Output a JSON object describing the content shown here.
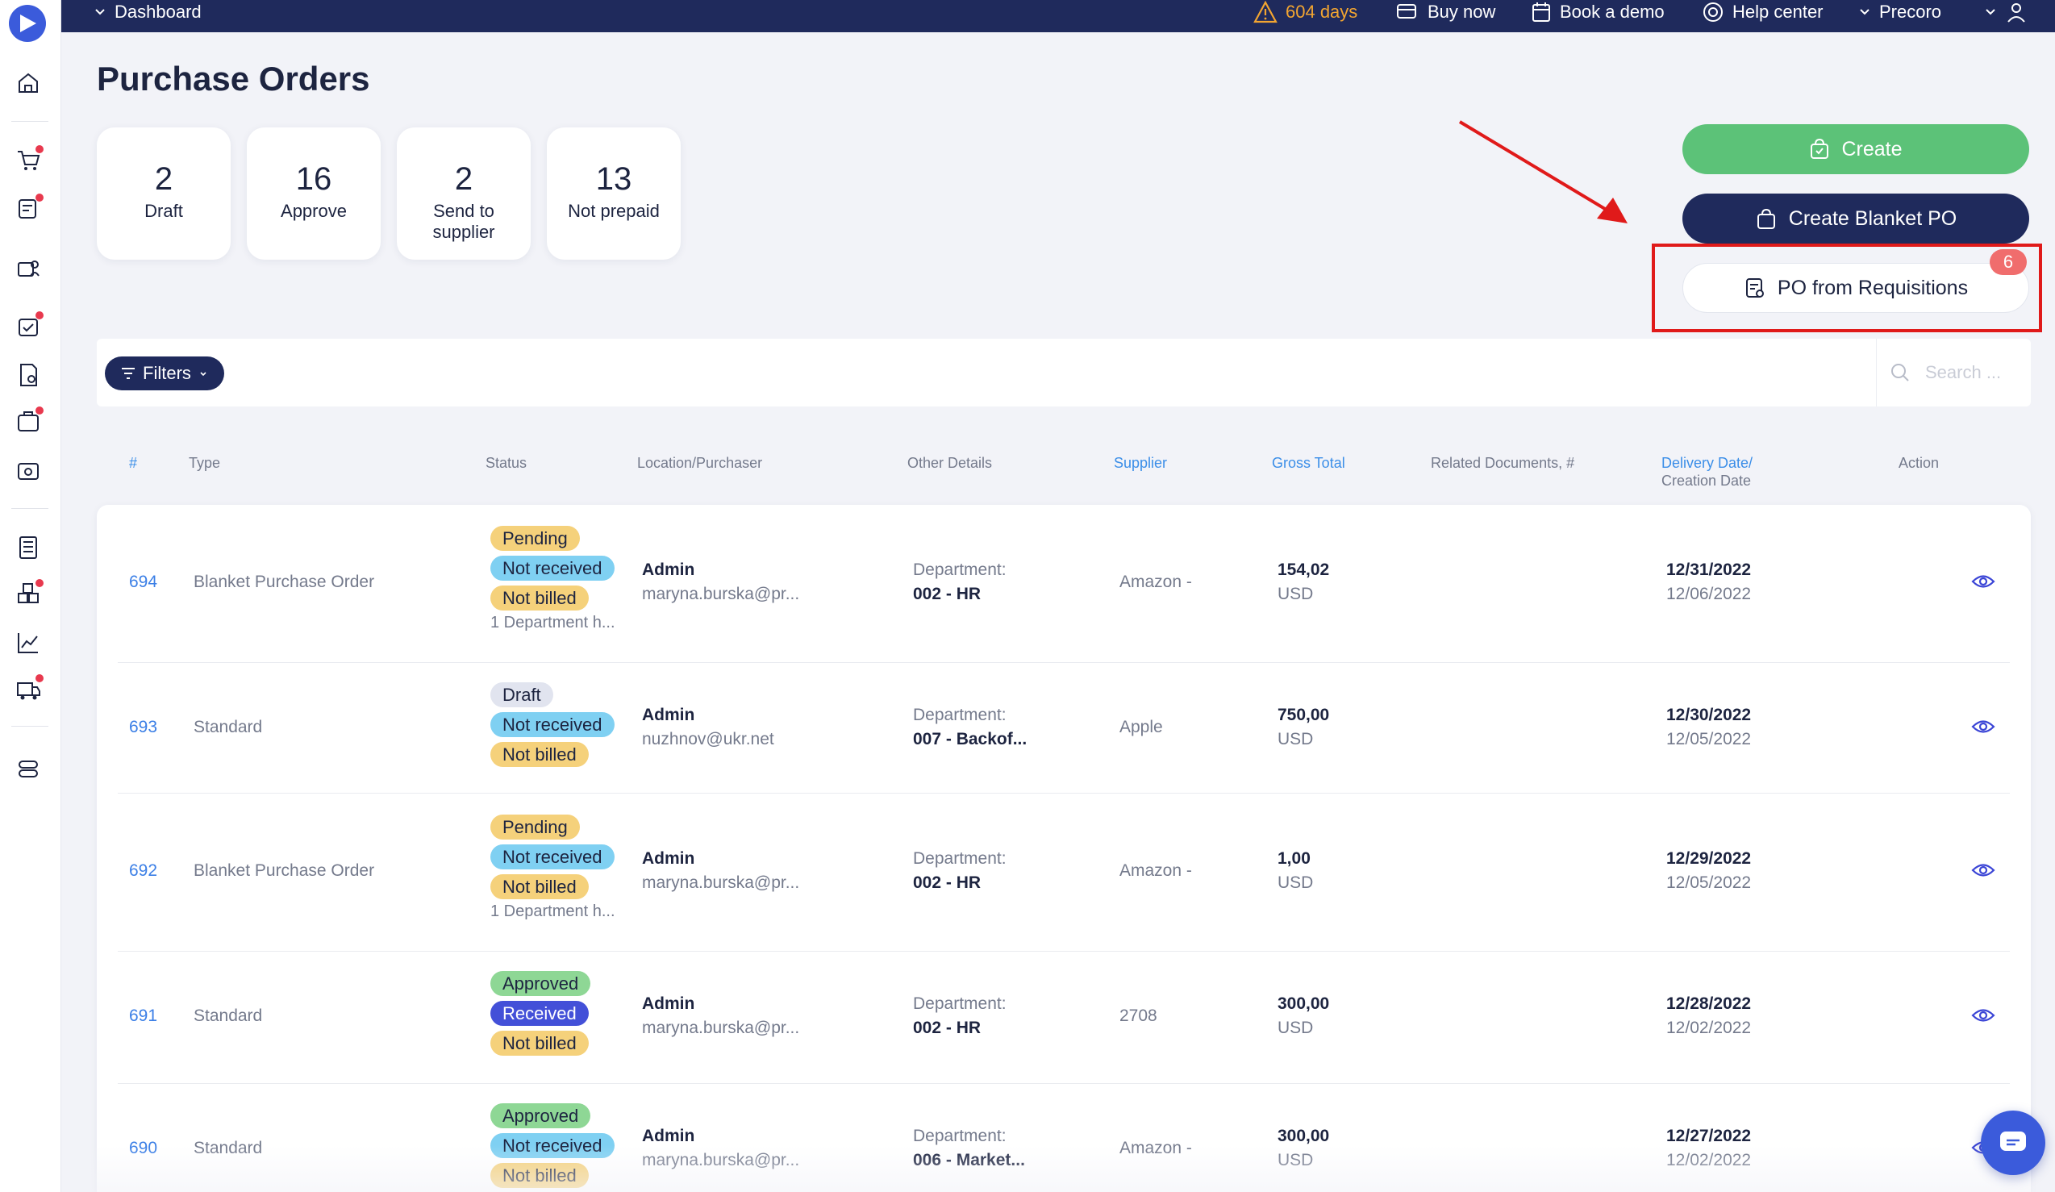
{
  "topbar": {
    "dashboard": "Dashboard",
    "trial": "604 days",
    "buy_now": "Buy now",
    "book_demo": "Book a demo",
    "help_center": "Help center",
    "company": "Precoro"
  },
  "page": {
    "title": "Purchase Orders"
  },
  "stats": [
    {
      "value": "2",
      "label": "Draft"
    },
    {
      "value": "16",
      "label": "Approve"
    },
    {
      "value": "2",
      "label": "Send to supplier"
    },
    {
      "value": "13",
      "label": "Not prepaid"
    }
  ],
  "actions": {
    "create": "Create",
    "create_blanket": "Create Blanket PO",
    "po_from_requisitions": "PO from Requisitions",
    "requisitions_count": "6"
  },
  "filters": {
    "label": "Filters",
    "search_placeholder": "Search ..."
  },
  "columns": {
    "num": "#",
    "type": "Type",
    "status": "Status",
    "location": "Location/Purchaser",
    "other": "Other Details",
    "supplier": "Supplier",
    "gross": "Gross Total",
    "related": "Related Documents, #",
    "delivery": "Delivery Date/",
    "creation": "Creation Date",
    "action": "Action"
  },
  "rows": [
    {
      "num": "694",
      "type": "Blanket Purchase Order",
      "statuses": [
        "Pending",
        "Not received",
        "Not billed"
      ],
      "note": "1 Department h...",
      "purchaser": "Admin",
      "email": "maryna.burska@pr...",
      "dept_label": "Department:",
      "dept": "002 - HR",
      "supplier": "Amazon -",
      "amount": "154,02",
      "currency": "USD",
      "delivery": "12/31/2022",
      "created": "12/06/2022"
    },
    {
      "num": "693",
      "type": "Standard",
      "statuses": [
        "Draft",
        "Not received",
        "Not billed"
      ],
      "note": "",
      "purchaser": "Admin",
      "email": "nuzhnov@ukr.net",
      "dept_label": "Department:",
      "dept": "007 - Backof...",
      "supplier": "Apple",
      "amount": "750,00",
      "currency": "USD",
      "delivery": "12/30/2022",
      "created": "12/05/2022"
    },
    {
      "num": "692",
      "type": "Blanket Purchase Order",
      "statuses": [
        "Pending",
        "Not received",
        "Not billed"
      ],
      "note": "1 Department h...",
      "purchaser": "Admin",
      "email": "maryna.burska@pr...",
      "dept_label": "Department:",
      "dept": "002 - HR",
      "supplier": "Amazon -",
      "amount": "1,00",
      "currency": "USD",
      "delivery": "12/29/2022",
      "created": "12/05/2022"
    },
    {
      "num": "691",
      "type": "Standard",
      "statuses": [
        "Approved",
        "Received",
        "Not billed"
      ],
      "note": "",
      "purchaser": "Admin",
      "email": "maryna.burska@pr...",
      "dept_label": "Department:",
      "dept": "002 - HR",
      "supplier": "2708",
      "amount": "300,00",
      "currency": "USD",
      "delivery": "12/28/2022",
      "created": "12/02/2022"
    },
    {
      "num": "690",
      "type": "Standard",
      "statuses": [
        "Approved",
        "Not received",
        "Not billed"
      ],
      "note": "",
      "purchaser": "Admin",
      "email": "maryna.burska@pr...",
      "dept_label": "Department:",
      "dept": "006 - Market...",
      "supplier": "Amazon -",
      "amount": "300,00",
      "currency": "USD",
      "delivery": "12/27/2022",
      "created": "12/02/2022"
    }
  ],
  "colors": {
    "navy": "#1f2a5c",
    "green": "#5cc278",
    "link_blue": "#3b7fe6",
    "highlight_red": "#e01a1a",
    "badge_red": "#f06d6d"
  },
  "icons": [
    "logo-icon",
    "home-icon",
    "cart-icon",
    "requisition-icon",
    "supplier-icon",
    "purchase-order-icon",
    "invoice-icon",
    "receipt-icon",
    "warehouse-icon",
    "budget-icon",
    "items-icon",
    "analytics-icon",
    "delivery-icon",
    "settings-icon",
    "warning-icon",
    "cart-buy-icon",
    "calendar-icon",
    "lifebuoy-icon",
    "user-icon",
    "filter-icon",
    "search-icon",
    "eye-icon",
    "chat-icon"
  ]
}
